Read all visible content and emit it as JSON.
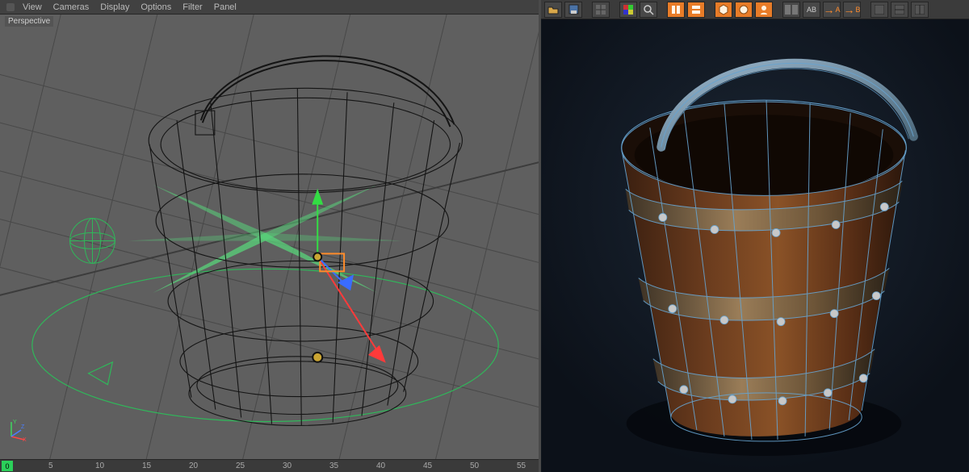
{
  "menus": {
    "view": "View",
    "cameras": "Cameras",
    "display": "Display",
    "options": "Options",
    "filter": "Filter",
    "panel": "Panel"
  },
  "viewport": {
    "label": "Perspective"
  },
  "timeline": {
    "current_frame": "0",
    "ticks": [
      "5",
      "10",
      "15",
      "20",
      "25",
      "30",
      "35",
      "40",
      "45",
      "50",
      "55"
    ]
  },
  "axis": {
    "x": "X",
    "y": "Y",
    "z": "Z"
  },
  "right_toolbar": {
    "icons": [
      {
        "name": "open-folder-icon"
      },
      {
        "name": "save-icon"
      },
      {
        "sep": true
      },
      {
        "name": "grid-icon"
      },
      {
        "sep": true
      },
      {
        "name": "swatch-icon"
      },
      {
        "name": "search-icon"
      },
      {
        "sep": true
      },
      {
        "name": "library-a-icon",
        "orange": true
      },
      {
        "name": "library-b-icon",
        "orange": true
      },
      {
        "sep": true
      },
      {
        "name": "cube-icon",
        "orange": true
      },
      {
        "name": "shaded-icon",
        "orange": true
      },
      {
        "name": "head-icon",
        "orange": true
      },
      {
        "sep": true
      },
      {
        "name": "ab-panel-icon"
      },
      {
        "name": "ab-text-icon"
      },
      {
        "name": "arrow-a-icon",
        "arrow": "A"
      },
      {
        "name": "arrow-b-icon",
        "arrow": "B"
      },
      {
        "sep": true
      },
      {
        "name": "uv-a-icon"
      },
      {
        "name": "uv-b-icon"
      },
      {
        "name": "uv-c-icon"
      }
    ]
  },
  "arrow_a_label": "A",
  "arrow_b_label": "B",
  "colors": {
    "accent_green": "#33dd66",
    "axis_red": "#ff3838",
    "axis_blue": "#3a6cff",
    "wire_dark": "#1a1a1a",
    "wire_cyan": "#6aa8d8",
    "wood1": "#5a2f17",
    "wood2": "#7a4423",
    "band": "#8a6a4a"
  }
}
